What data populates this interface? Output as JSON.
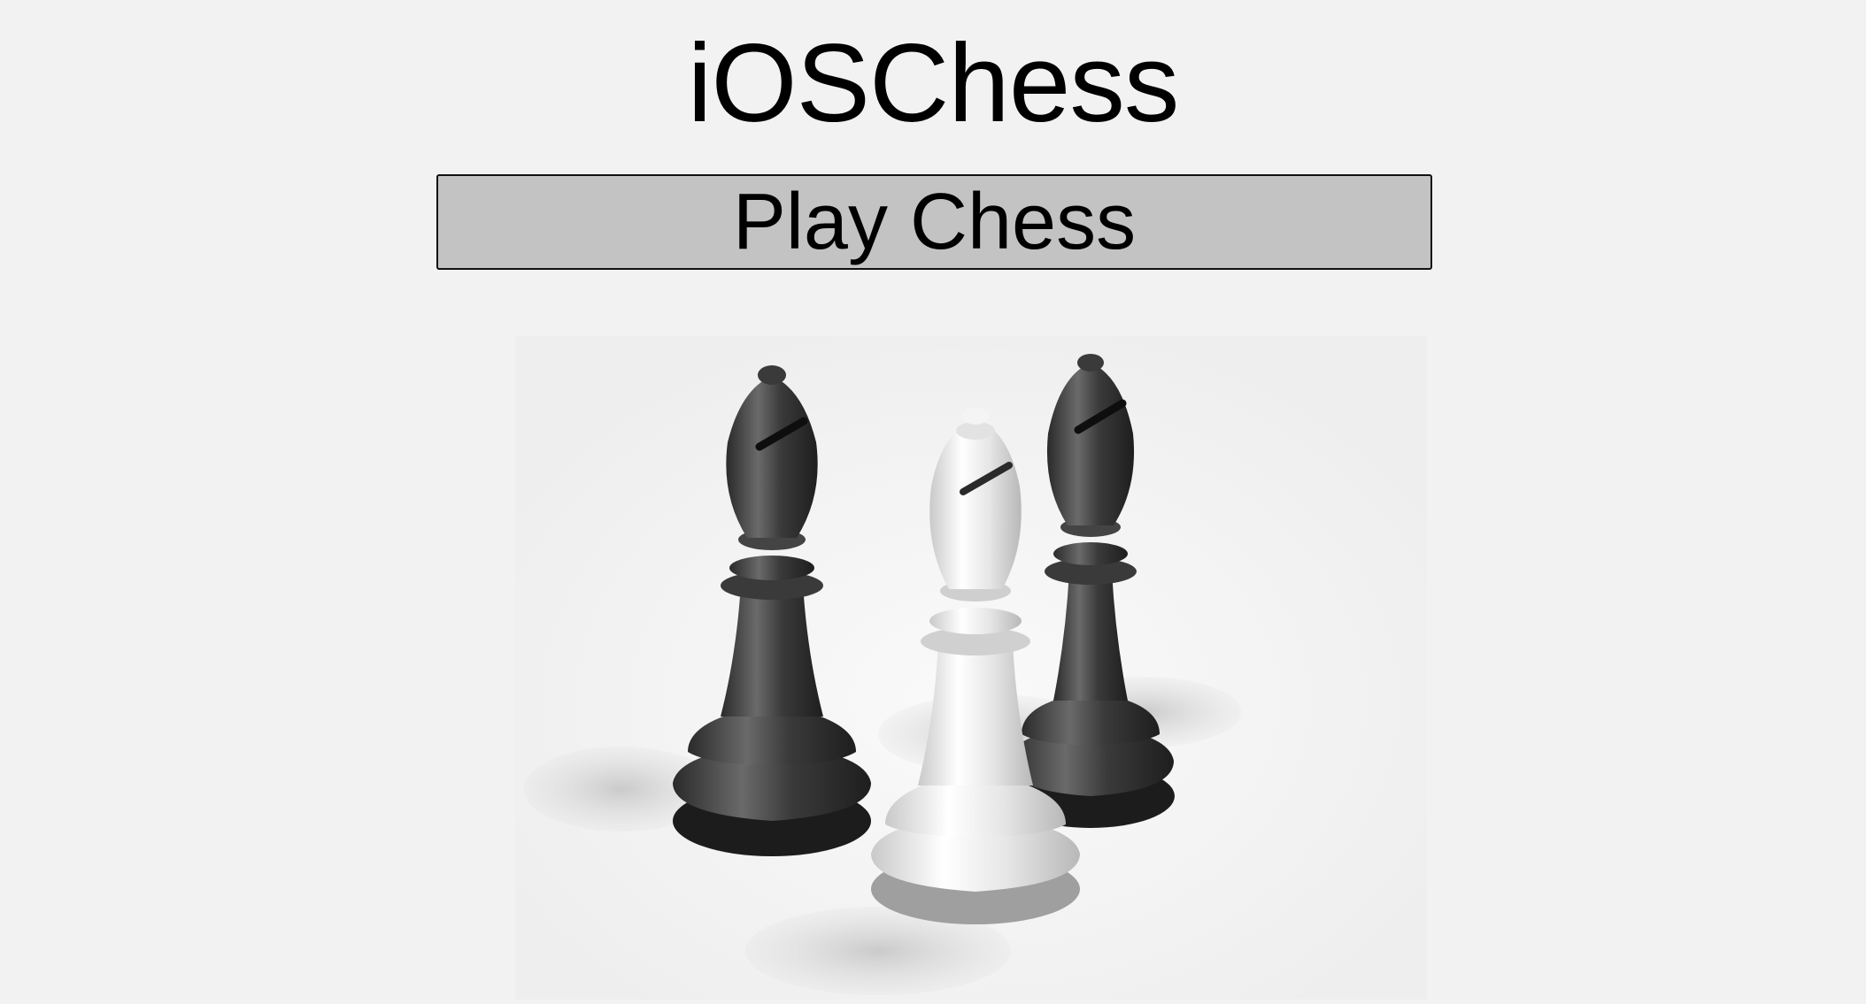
{
  "app": {
    "title": "iOSChess"
  },
  "main": {
    "play_label": "Play Chess",
    "hero_icon": "chess-bishops-image"
  }
}
